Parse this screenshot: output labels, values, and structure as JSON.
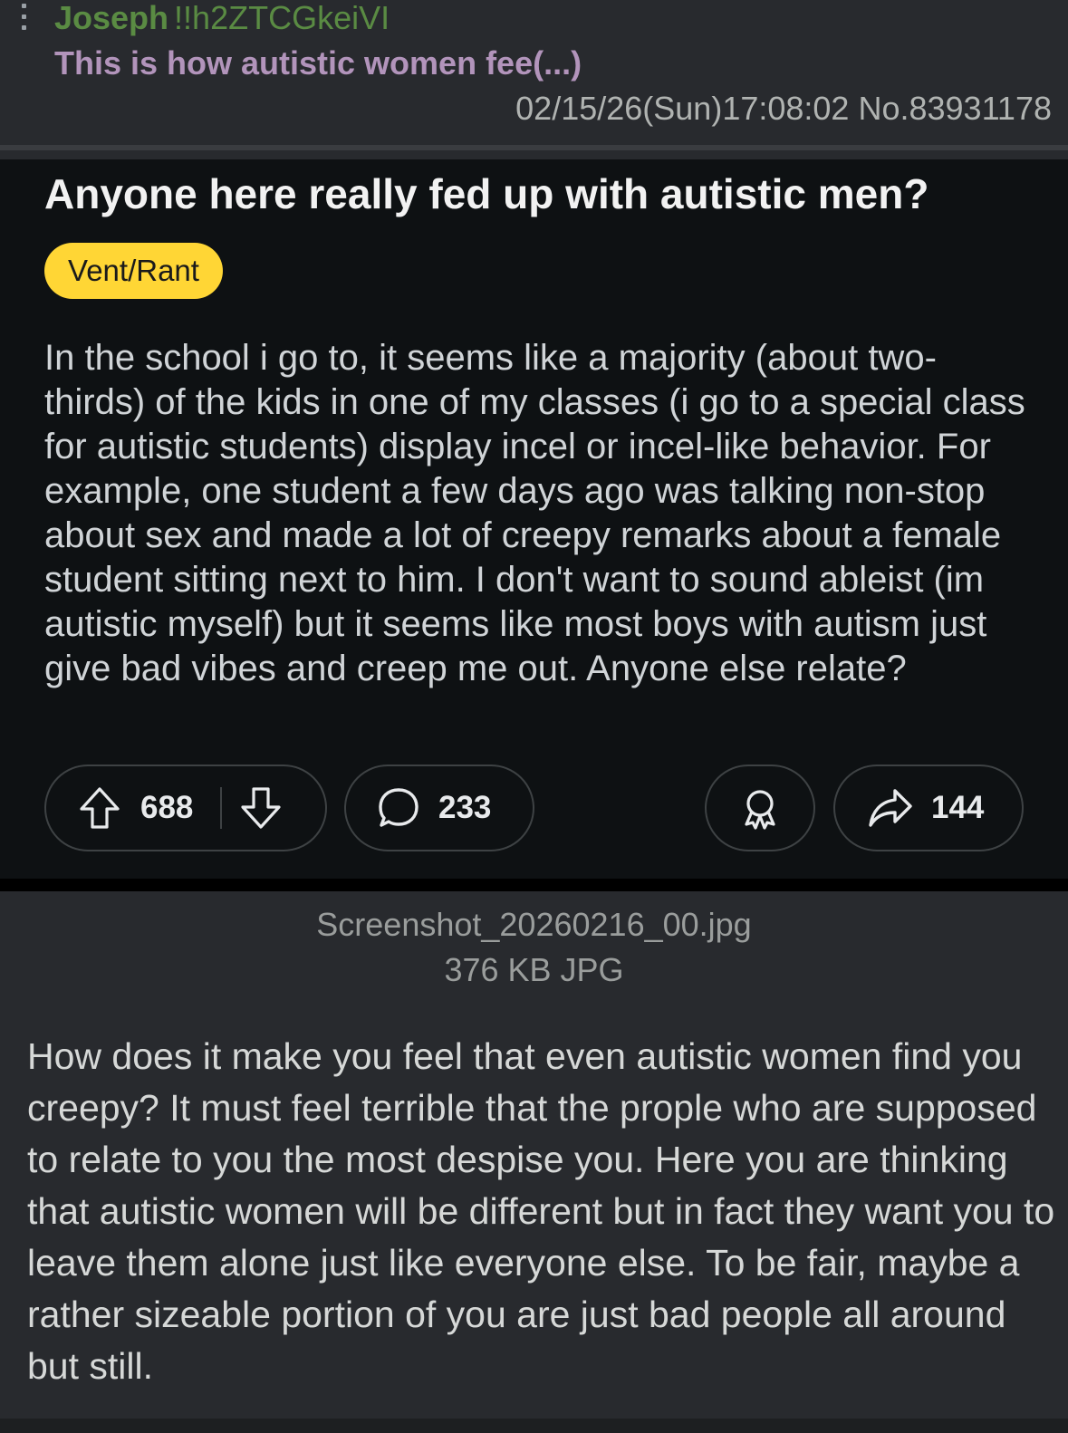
{
  "post": {
    "name": "Joseph",
    "tripcode": "!!h2ZTCGkeiVI",
    "subject": "This is how autistic women fee(...)",
    "date": "02/15/26(Sun)17:08:02",
    "number": "No.83931178"
  },
  "embedded_post": {
    "title": "Anyone here really fed up with autistic men?",
    "flair": "Vent/Rant",
    "body": "In the school i go to, it seems like a majority (about two-thirds) of the kids in one of my classes (i go to a special class for autistic students) display incel or incel-like behavior. For example, one student a few days ago was talking non-stop about sex and made a lot of creepy remarks about a female student sitting next to him. I don't want to sound ableist (im autistic myself) but it seems like most boys with autism just give bad vibes and creep me out. Anyone else relate?",
    "upvotes": "688",
    "comments": "233",
    "shares": "144",
    "icons": {
      "upvote": "arrow-up-icon",
      "downvote": "arrow-down-icon",
      "comment": "speech-bubble-icon",
      "award": "award-icon",
      "share": "share-arrow-icon"
    },
    "colors": {
      "flair_background": "#ffd635",
      "card_background": "#0e1113"
    }
  },
  "file": {
    "filename": "Screenshot_20260216_00.jpg",
    "size": "376 KB JPG"
  },
  "reply": {
    "text": "How does it make you feel that even autistic women find you creepy? It must feel terrible that the prople who are supposed to relate to you the most despise you. Here you are thinking that autistic women will be different but in fact they want you to leave them alone just like everyone else. To be fair, maybe a rather sizeable portion of you are just bad people all around but still."
  },
  "colors": {
    "name": "#5a8b43",
    "subject": "#b294bb",
    "background": "#282a2e"
  }
}
